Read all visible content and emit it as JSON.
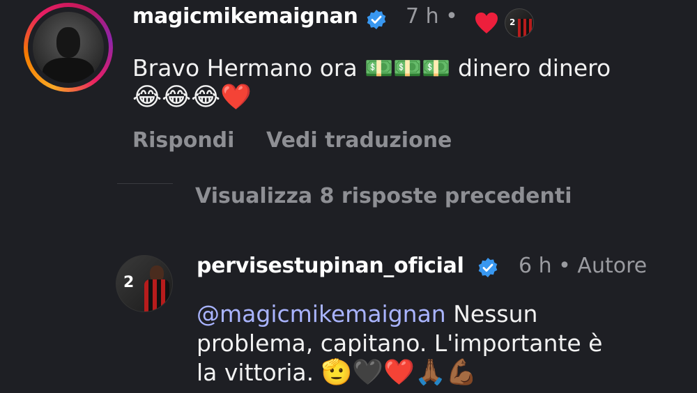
{
  "comment1": {
    "username": "magicmikemaignan",
    "time": "7 h",
    "text_line1_a": "Bravo Hermano ora ",
    "text_line1_emoji": "💵💵💵",
    "text_line1_b": " dinero dinero",
    "text_line2_emoji": "😂😂😂❤️",
    "reply_label": "Rispondi",
    "translate_label": "Vedi traduzione"
  },
  "view_replies_label": "Visualizza 8 risposte precedenti",
  "comment2": {
    "username": "pervisestupinan_oficial",
    "time": "6 h",
    "author_label": "Autore",
    "mention": "@magicmikemaignan",
    "text_line1": " Nessun",
    "text_line2": "problema, capitano. L'importante è",
    "text_line3": "la vittoria. ",
    "text_line3_emoji": "🫡🖤❤️🙏🏾💪🏾",
    "avatar_number": "2"
  },
  "colors": {
    "background": "#1e1f24",
    "verified": "#3897f0",
    "like_heart": "#ed1f3c",
    "mention": "#a9b4ff"
  },
  "icons": [
    "verified-badge-icon",
    "like-heart-icon",
    "avatar"
  ]
}
